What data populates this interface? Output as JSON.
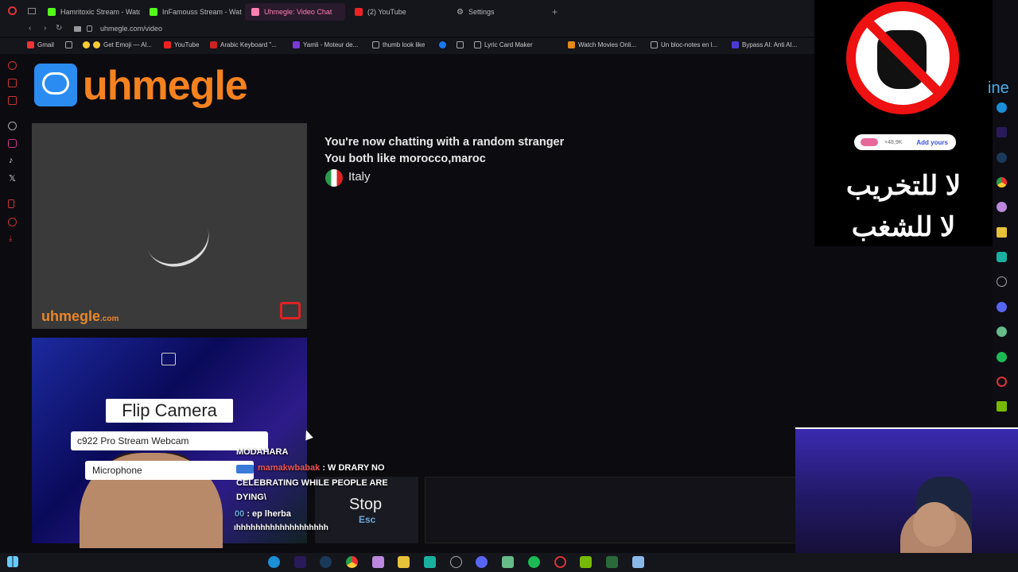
{
  "tabs": [
    {
      "label": "Hamritoxic Stream - Watc"
    },
    {
      "label": "InFamouss Stream - Watc"
    },
    {
      "label": "Uhmegle: Video Chat"
    },
    {
      "label": "(2) YouTube"
    },
    {
      "label": "Settings"
    }
  ],
  "address": {
    "url": "uhmegle.com/video"
  },
  "bookmarks": [
    {
      "label": "Gmail"
    },
    {
      "label": "Get Emoji — Al..."
    },
    {
      "label": "YouTube"
    },
    {
      "label": "Arabic Keyboard \"..."
    },
    {
      "label": "Yamli - Moteur de..."
    },
    {
      "label": "thumb look like"
    },
    {
      "label": "Lyric Card Maker"
    },
    {
      "label": "Watch Movies Onli..."
    },
    {
      "label": "Un bloc-notes en l..."
    },
    {
      "label": "Bypass AI: Anti AI..."
    }
  ],
  "site": {
    "logo_text": "uhmegle",
    "watermark": "uhmegle",
    "watermark_suffix": ".com"
  },
  "chat": {
    "status_line": "You're now chatting with a random stranger",
    "interests_line": "You both like morocco,maroc",
    "country": "Italy"
  },
  "self_video": {
    "flip_label": "Flip Camera",
    "camera_select": "c922 Pro Stream Webcam",
    "mic_select": "Microphone"
  },
  "controls": {
    "stop_label": "Stop",
    "stop_key": "Esc"
  },
  "stream_chat": {
    "line1": "MODAHARA",
    "user2": "mamakwbabak",
    "msg2a": ": W DRARY NO",
    "msg2b": "CELEBRATING WHILE PEOPLE ARE",
    "msg2c": "DYING\\",
    "user3": "00",
    "msg3": ": ep lherba",
    "line4": "ıhhhhhhhhhhhhhhhhhhh"
  },
  "stream_overlay": {
    "social_count": "+48,9K",
    "social_cta": "Add yours",
    "arabic_line1": "لا للتخريب",
    "arabic_line2": "لا للشغب",
    "partial_text": "ine"
  },
  "colors": {
    "brand_orange": "#f5821f",
    "brand_blue": "#2a8cf0",
    "active_tab": "#ff7fb0",
    "stop_red": "#e11"
  }
}
